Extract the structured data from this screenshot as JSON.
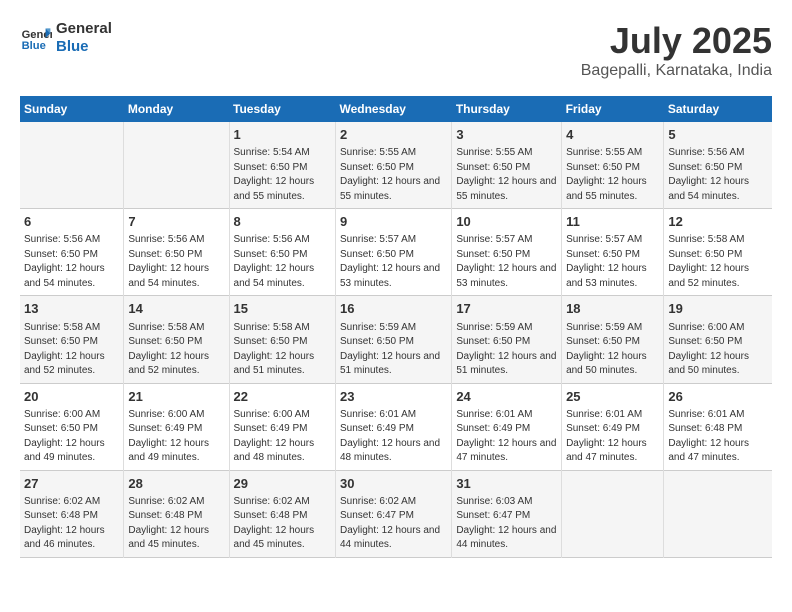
{
  "logo": {
    "text_general": "General",
    "text_blue": "Blue"
  },
  "title": "July 2025",
  "subtitle": "Bagepalli, Karnataka, India",
  "weekdays": [
    "Sunday",
    "Monday",
    "Tuesday",
    "Wednesday",
    "Thursday",
    "Friday",
    "Saturday"
  ],
  "weeks": [
    [
      {
        "day": "",
        "info": ""
      },
      {
        "day": "",
        "info": ""
      },
      {
        "day": "1",
        "info": "Sunrise: 5:54 AM\nSunset: 6:50 PM\nDaylight: 12 hours and 55 minutes."
      },
      {
        "day": "2",
        "info": "Sunrise: 5:55 AM\nSunset: 6:50 PM\nDaylight: 12 hours and 55 minutes."
      },
      {
        "day": "3",
        "info": "Sunrise: 5:55 AM\nSunset: 6:50 PM\nDaylight: 12 hours and 55 minutes."
      },
      {
        "day": "4",
        "info": "Sunrise: 5:55 AM\nSunset: 6:50 PM\nDaylight: 12 hours and 55 minutes."
      },
      {
        "day": "5",
        "info": "Sunrise: 5:56 AM\nSunset: 6:50 PM\nDaylight: 12 hours and 54 minutes."
      }
    ],
    [
      {
        "day": "6",
        "info": "Sunrise: 5:56 AM\nSunset: 6:50 PM\nDaylight: 12 hours and 54 minutes."
      },
      {
        "day": "7",
        "info": "Sunrise: 5:56 AM\nSunset: 6:50 PM\nDaylight: 12 hours and 54 minutes."
      },
      {
        "day": "8",
        "info": "Sunrise: 5:56 AM\nSunset: 6:50 PM\nDaylight: 12 hours and 54 minutes."
      },
      {
        "day": "9",
        "info": "Sunrise: 5:57 AM\nSunset: 6:50 PM\nDaylight: 12 hours and 53 minutes."
      },
      {
        "day": "10",
        "info": "Sunrise: 5:57 AM\nSunset: 6:50 PM\nDaylight: 12 hours and 53 minutes."
      },
      {
        "day": "11",
        "info": "Sunrise: 5:57 AM\nSunset: 6:50 PM\nDaylight: 12 hours and 53 minutes."
      },
      {
        "day": "12",
        "info": "Sunrise: 5:58 AM\nSunset: 6:50 PM\nDaylight: 12 hours and 52 minutes."
      }
    ],
    [
      {
        "day": "13",
        "info": "Sunrise: 5:58 AM\nSunset: 6:50 PM\nDaylight: 12 hours and 52 minutes."
      },
      {
        "day": "14",
        "info": "Sunrise: 5:58 AM\nSunset: 6:50 PM\nDaylight: 12 hours and 52 minutes."
      },
      {
        "day": "15",
        "info": "Sunrise: 5:58 AM\nSunset: 6:50 PM\nDaylight: 12 hours and 51 minutes."
      },
      {
        "day": "16",
        "info": "Sunrise: 5:59 AM\nSunset: 6:50 PM\nDaylight: 12 hours and 51 minutes."
      },
      {
        "day": "17",
        "info": "Sunrise: 5:59 AM\nSunset: 6:50 PM\nDaylight: 12 hours and 51 minutes."
      },
      {
        "day": "18",
        "info": "Sunrise: 5:59 AM\nSunset: 6:50 PM\nDaylight: 12 hours and 50 minutes."
      },
      {
        "day": "19",
        "info": "Sunrise: 6:00 AM\nSunset: 6:50 PM\nDaylight: 12 hours and 50 minutes."
      }
    ],
    [
      {
        "day": "20",
        "info": "Sunrise: 6:00 AM\nSunset: 6:50 PM\nDaylight: 12 hours and 49 minutes."
      },
      {
        "day": "21",
        "info": "Sunrise: 6:00 AM\nSunset: 6:49 PM\nDaylight: 12 hours and 49 minutes."
      },
      {
        "day": "22",
        "info": "Sunrise: 6:00 AM\nSunset: 6:49 PM\nDaylight: 12 hours and 48 minutes."
      },
      {
        "day": "23",
        "info": "Sunrise: 6:01 AM\nSunset: 6:49 PM\nDaylight: 12 hours and 48 minutes."
      },
      {
        "day": "24",
        "info": "Sunrise: 6:01 AM\nSunset: 6:49 PM\nDaylight: 12 hours and 47 minutes."
      },
      {
        "day": "25",
        "info": "Sunrise: 6:01 AM\nSunset: 6:49 PM\nDaylight: 12 hours and 47 minutes."
      },
      {
        "day": "26",
        "info": "Sunrise: 6:01 AM\nSunset: 6:48 PM\nDaylight: 12 hours and 47 minutes."
      }
    ],
    [
      {
        "day": "27",
        "info": "Sunrise: 6:02 AM\nSunset: 6:48 PM\nDaylight: 12 hours and 46 minutes."
      },
      {
        "day": "28",
        "info": "Sunrise: 6:02 AM\nSunset: 6:48 PM\nDaylight: 12 hours and 45 minutes."
      },
      {
        "day": "29",
        "info": "Sunrise: 6:02 AM\nSunset: 6:48 PM\nDaylight: 12 hours and 45 minutes."
      },
      {
        "day": "30",
        "info": "Sunrise: 6:02 AM\nSunset: 6:47 PM\nDaylight: 12 hours and 44 minutes."
      },
      {
        "day": "31",
        "info": "Sunrise: 6:03 AM\nSunset: 6:47 PM\nDaylight: 12 hours and 44 minutes."
      },
      {
        "day": "",
        "info": ""
      },
      {
        "day": "",
        "info": ""
      }
    ]
  ]
}
